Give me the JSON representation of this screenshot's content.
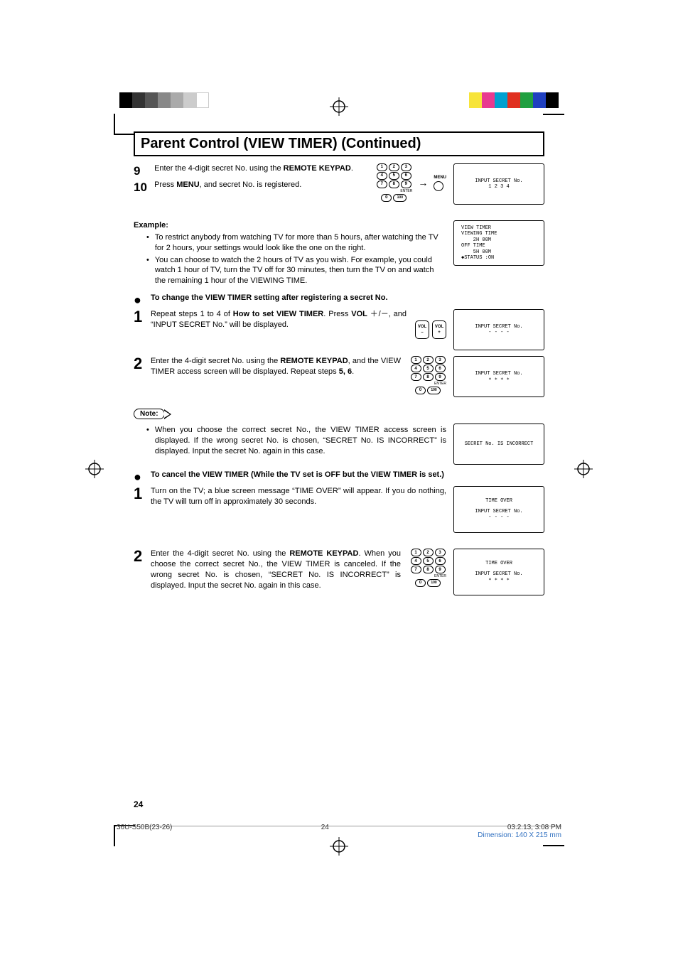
{
  "title": "Parent Control (VIEW TIMER) (Continued)",
  "step9": {
    "num": "9",
    "pre": "Enter the 4-digit secret No. using the ",
    "bold": "REMOTE KEYPAD",
    "post": "."
  },
  "step10": {
    "num": "10",
    "pre": "Press ",
    "bold": "MENU",
    "post": ", and secret No. is registered."
  },
  "screen1": {
    "line1": "INPUT SECRET No.",
    "line2": "1 2 3 4"
  },
  "example": {
    "heading": "Example:",
    "b1": "To restrict anybody from watching TV for more than 5 hours, after watching the TV for 2 hours, your settings would look like the one on the right.",
    "b2": "You can choose to watch the 2 hours of TV as you wish. For example, you could watch 1 hour of TV, turn the TV off for 30 minutes, then turn the TV on and watch the remaining 1 hour of the VIEWING TIME."
  },
  "screen2": {
    "l1": "VIEW TIMER",
    "l2": "VIEWING TIME",
    "l3": "    2H 00M",
    "l4": "OFF TIME",
    "l5": "    5H 00M",
    "l6": "◆STATUS :ON"
  },
  "subA": {
    "heading": "To change the VIEW TIMER setting after registering a secret No."
  },
  "a1": {
    "num": "1",
    "pre": "Repeat steps 1 to 4 of ",
    "bold1": "How to set VIEW TIMER",
    "mid": ". Press ",
    "bold2": "VOL",
    "sym": " ＋/－, and “INPUT SECRET No.” will be displayed."
  },
  "screen3": {
    "line1": "INPUT SECRET No.",
    "line2": "- - - -"
  },
  "a2": {
    "num": "2",
    "pre": "Enter the 4-digit secret No. using the ",
    "bold1": "REMOTE KEYPAD",
    "mid": ", and the VIEW TIMER access screen will be displayed. Repeat steps ",
    "bold2": "5, 6",
    "post": "."
  },
  "screen4": {
    "line1": "INPUT SECRET No.",
    "line2": "∗ ∗ ∗ ∗"
  },
  "note": {
    "label": "Note:",
    "text": "When you choose the correct secret No., the VIEW TIMER access screen is displayed. If the wrong secret No. is chosen, “SECRET No. IS INCORRECT” is displayed. Input the secret No. again in this case."
  },
  "screen5": {
    "line1": "SECRET No. IS INCORRECT"
  },
  "subB": {
    "heading": "To cancel the VIEW TIMER (While the TV set is OFF but the VIEW TIMER is set.)"
  },
  "b1step": {
    "num": "1",
    "text": "Turn on the TV; a blue screen message “TIME OVER” will appear. If you do nothing, the TV will turn off in approximately 30 seconds."
  },
  "screen6": {
    "line1": "TIME OVER",
    "line2": "INPUT SECRET No.",
    "line3": "- - - -"
  },
  "b2step": {
    "num": "2",
    "pre": "Enter the 4-digit secret No. using the ",
    "bold1": "REMOTE KEYPAD",
    "post": ". When you choose the correct secret No., the VIEW TIMER is canceled. If the wrong secret No. is chosen, “SECRET No. IS INCORRECT” is displayed. Input the secret No. again in this case."
  },
  "screen7": {
    "line1": "TIME OVER",
    "line2": "INPUT SECRET No.",
    "line3": "∗ ∗ ∗ ∗"
  },
  "keypad": {
    "r1": [
      "1",
      "2",
      "3"
    ],
    "r2": [
      "4",
      "5",
      "6"
    ],
    "r3": [
      "7",
      "8",
      "9"
    ],
    "r4": [
      "0",
      "100"
    ],
    "enter": "ENTER"
  },
  "vol": {
    "label": "VOL",
    "minus": "–",
    "plus": "+"
  },
  "menu": {
    "label": "MENU"
  },
  "pageNum": "24",
  "footer": {
    "left": "36U-S50B(23-26)",
    "center": "24",
    "right": "03.2.13, 3:08 PM",
    "dim": "Dimension: 140  X 215 mm"
  }
}
